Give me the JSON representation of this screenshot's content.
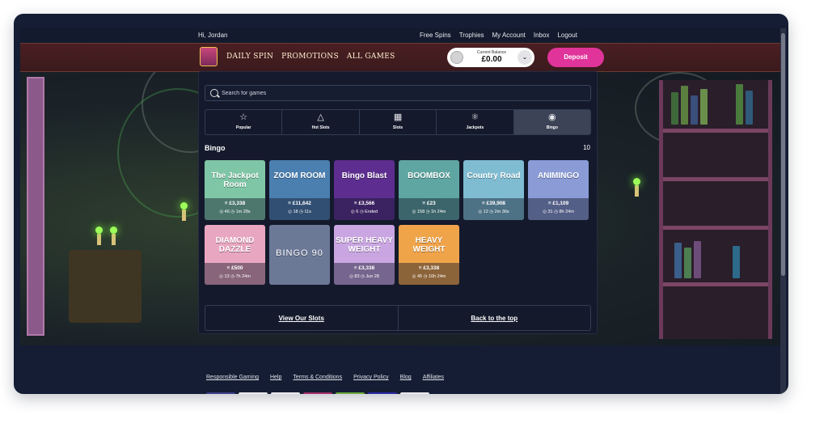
{
  "topbar": {
    "greeting": "Hi, Jordan",
    "links": [
      "Free Spins",
      "Trophies",
      "My Account",
      "Inbox",
      "Logout"
    ]
  },
  "nav": {
    "links": [
      "DAILY SPIN",
      "PROMOTIONS",
      "ALL GAMES"
    ],
    "balance_label": "Current Balance",
    "balance_value": "£0.00",
    "deposit_label": "Deposit"
  },
  "search": {
    "placeholder": "Search for games"
  },
  "categories": [
    {
      "label": "Popular",
      "icon": "star-icon",
      "active": false
    },
    {
      "label": "Hot Slots",
      "icon": "flame-icon",
      "active": false
    },
    {
      "label": "Slots",
      "icon": "slot-machine-icon",
      "active": false
    },
    {
      "label": "Jackpots",
      "icon": "jackpot-icon",
      "active": false
    },
    {
      "label": "Bingo",
      "icon": "bingo-icon",
      "active": true
    }
  ],
  "section": {
    "title": "Bingo",
    "count": "10"
  },
  "games": [
    {
      "title": "The Jackpot Room",
      "jackpot": "£3,338",
      "players": "46",
      "time": "1m 28s",
      "color": "#7fc6a6"
    },
    {
      "title": "ZOOM ROOM",
      "jackpot": "£11,642",
      "players": "18",
      "time": "11s",
      "color": "#4b7fb0"
    },
    {
      "title": "Bingo Blast",
      "jackpot": "£3,566",
      "players": "6",
      "time": "Ended",
      "color": "#5d2d8f"
    },
    {
      "title": "BOOMBOX",
      "jackpot": "£23",
      "players": "158",
      "time": "1h 24m",
      "color": "#5fa6a2"
    },
    {
      "title": "Country Road",
      "jackpot": "£39,908",
      "players": "12",
      "time": "2m 36s",
      "color": "#7fbcd2"
    },
    {
      "title": "ANIMINGO",
      "jackpot": "£1,109",
      "players": "31",
      "time": "8h 24m",
      "color": "#8a9bd6"
    },
    {
      "title": "DIAMOND DAZZLE",
      "jackpot": "£500",
      "players": "13",
      "time": "7h 24m",
      "color": "#e9a6c0"
    },
    {
      "title": "BINGO 90",
      "jackpot": "",
      "players": "",
      "time": "",
      "color": "#6b7896"
    },
    {
      "title": "SUPER HEAVY WEIGHT",
      "jackpot": "£3,338",
      "players": "83",
      "time": "Jun 28",
      "color": "#c9a6e2"
    },
    {
      "title": "HEAVY WEIGHT",
      "jackpot": "£3,338",
      "players": "45",
      "time": "10h 24m",
      "color": "#f0a44a"
    }
  ],
  "bottom": {
    "view_slots": "View Our Slots",
    "back_top": "Back to the top"
  },
  "footer": {
    "links": [
      "Responsible Gaming",
      "Help",
      "Terms & Conditions",
      "Privacy Policy",
      "Blog",
      "Affiliates"
    ]
  }
}
